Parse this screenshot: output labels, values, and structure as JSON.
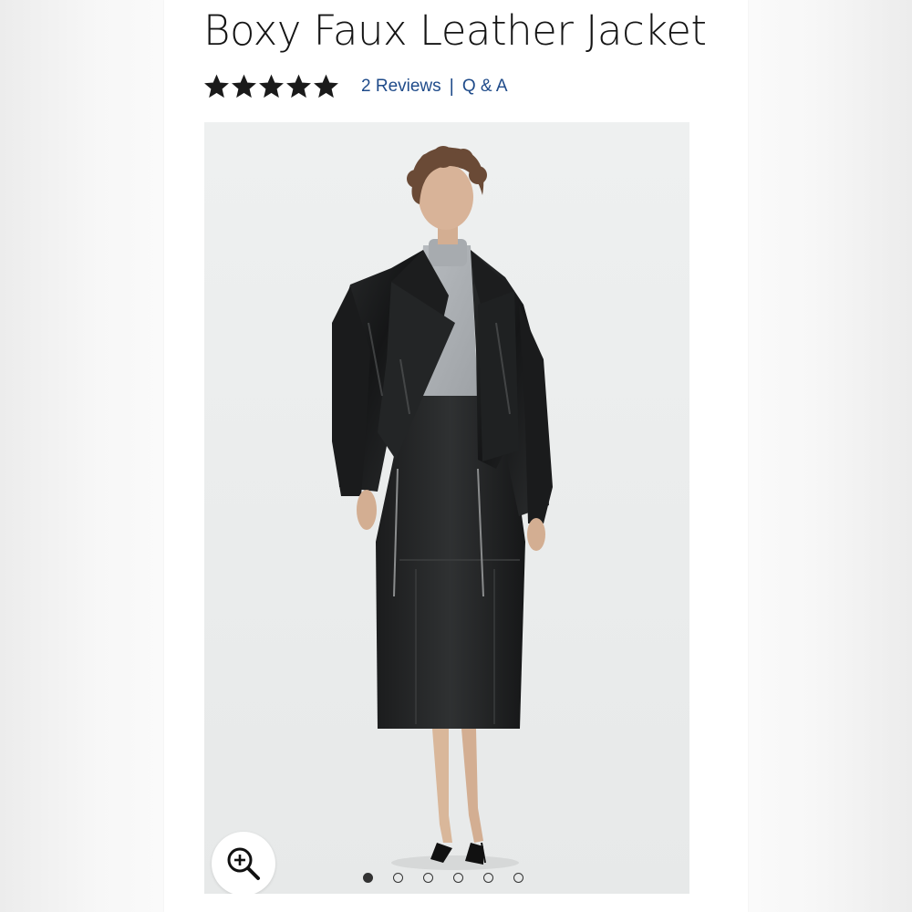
{
  "product": {
    "title": "Boxy Faux Leather Jacket",
    "rating": {
      "stars": 5,
      "max": 5
    },
    "reviews_label": "2 Reviews",
    "separator": "|",
    "qa_label": "Q & A"
  },
  "gallery": {
    "current_index": 1,
    "total_images": 6,
    "zoom_icon": "zoom-in-icon"
  },
  "colors": {
    "link": "#1f4b8a",
    "title": "#151515",
    "star": "#1a1a1a"
  }
}
